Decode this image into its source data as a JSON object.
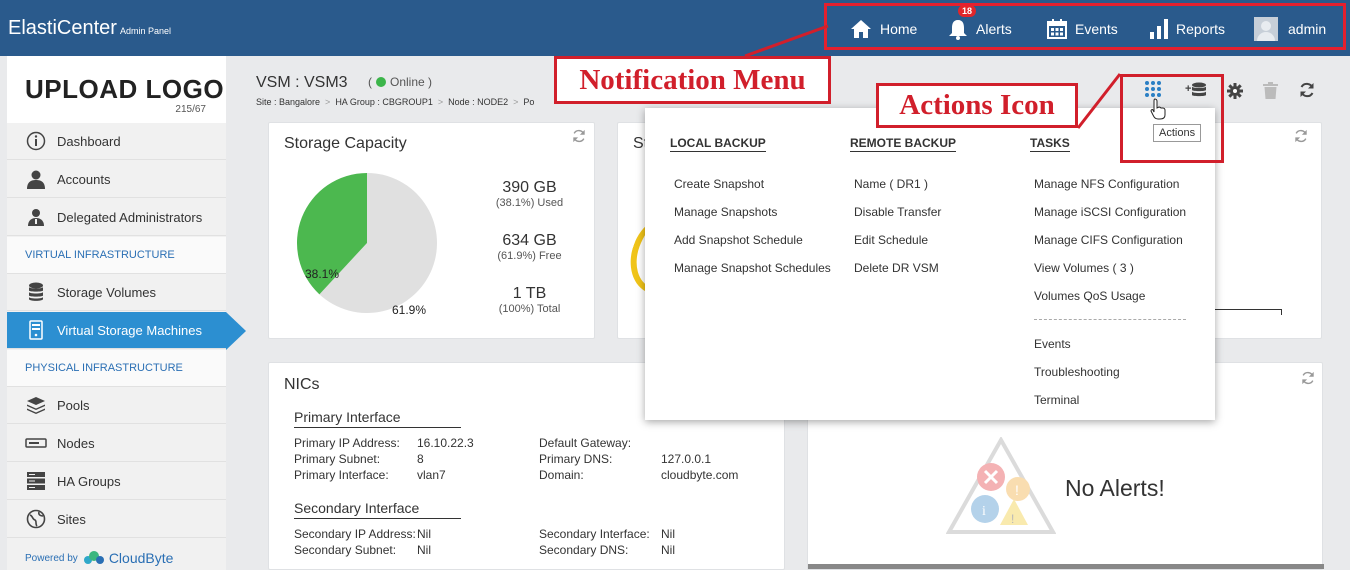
{
  "app": {
    "name": "ElastiCenter",
    "subtitle": "Admin Panel"
  },
  "topnav": {
    "home": "Home",
    "alerts": "Alerts",
    "alerts_badge": "18",
    "events": "Events",
    "reports": "Reports",
    "user": "admin"
  },
  "sidebar": {
    "logo_text": "UPLOAD LOGO",
    "logo_size": "215/67",
    "items": [
      {
        "label": "Dashboard",
        "icon": "info-icon"
      },
      {
        "label": "Accounts",
        "icon": "user-icon"
      },
      {
        "label": "Delegated Administrators",
        "icon": "admin-icon"
      }
    ],
    "virtual_header": "VIRTUAL INFRASTRUCTURE",
    "virtual_items": [
      {
        "label": "Storage Volumes",
        "icon": "database-icon"
      },
      {
        "label": "Virtual Storage Machines",
        "icon": "vsm-icon",
        "active": true
      }
    ],
    "physical_header": "PHYSICAL INFRASTRUCTURE",
    "physical_items": [
      {
        "label": "Pools",
        "icon": "layers-icon"
      },
      {
        "label": "Nodes",
        "icon": "node-icon"
      },
      {
        "label": "HA Groups",
        "icon": "server-icon"
      },
      {
        "label": "Sites",
        "icon": "globe-icon"
      }
    ],
    "powered_by": "Powered by",
    "powered_brand": "CloudByte"
  },
  "page": {
    "title": "VSM : VSM3",
    "status": "Online",
    "breadcrumb": [
      "Site : Bangalore",
      "HA Group : CBGROUP1",
      "Node : NODE2",
      "Po"
    ]
  },
  "storage": {
    "title": "Storage Capacity",
    "used_value": "390 GB",
    "used_label": "(38.1%) Used",
    "free_value": "634 GB",
    "free_label": "(61.9%) Free",
    "total_value": "1 TB",
    "total_label": "(100%) Total",
    "pie_used_label": "38.1%",
    "pie_free_label": "61.9%",
    "used_fraction": 0.381,
    "used_color": "#4cb84f",
    "free_color": "#e0e0e0"
  },
  "panel2": {
    "title_partial": "St"
  },
  "nics": {
    "title": "NICs",
    "primary_heading": "Primary Interface",
    "primary_left": [
      {
        "k": "Primary IP Address:",
        "v": "16.10.22.3"
      },
      {
        "k": "Primary Subnet:",
        "v": "8"
      },
      {
        "k": "Primary Interface:",
        "v": "vlan7"
      }
    ],
    "primary_right": [
      {
        "k": "Default Gateway:",
        "v": ""
      },
      {
        "k": "Primary DNS:",
        "v": "127.0.0.1"
      },
      {
        "k": "Domain:",
        "v": "cloudbyte.com"
      }
    ],
    "secondary_heading": "Secondary Interface",
    "secondary_left": [
      {
        "k": "Secondary IP Address:",
        "v": "Nil"
      },
      {
        "k": "Secondary Subnet:",
        "v": "Nil"
      }
    ],
    "secondary_right": [
      {
        "k": "Secondary Interface:",
        "v": "Nil"
      },
      {
        "k": "Secondary DNS:",
        "v": "Nil"
      }
    ]
  },
  "alerts_panel": {
    "empty_text": "No Alerts!"
  },
  "actions_menu": {
    "local_backup": {
      "heading": "LOCAL BACKUP",
      "items": [
        "Create Snapshot",
        "Manage Snapshots",
        "Add Snapshot Schedule",
        "Manage Snapshot Schedules"
      ]
    },
    "remote_backup": {
      "heading": "REMOTE BACKUP",
      "items": [
        "Name ( DR1 )",
        "Disable Transfer",
        "Edit Schedule",
        "Delete DR VSM"
      ]
    },
    "tasks": {
      "heading": "TASKS",
      "items": [
        "Manage NFS Configuration",
        "Manage iSCSI Configuration",
        "Manage CIFS Configuration",
        "View Volumes ( 3 )",
        "Volumes QoS Usage"
      ],
      "more_items": [
        "Events",
        "Troubleshooting",
        "Terminal"
      ]
    }
  },
  "tooltip": "Actions",
  "annotations": {
    "notification_menu": "Notification Menu",
    "actions_icon": "Actions Icon"
  },
  "colors": {
    "topbar": "#2a5a8c",
    "accent": "#2c8fd1",
    "annotation": "#d11f2b",
    "online": "#3cb54a"
  }
}
